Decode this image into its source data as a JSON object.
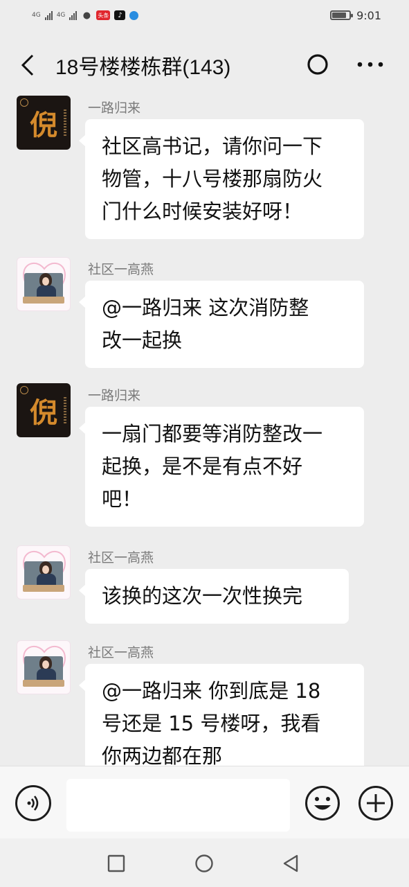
{
  "status_bar": {
    "network_1": "4G",
    "network_2": "4G",
    "time": "9:01",
    "icons": [
      "signal-icon",
      "signal-icon",
      "wechat-icon",
      "toutiao-icon",
      "tiktok-icon",
      "browser-icon"
    ],
    "battery_level": 0.85,
    "toutiao_label": "头条"
  },
  "header": {
    "title": "18号楼楼栋群(143)",
    "back_icon": "chevron-left-icon",
    "refresh_icon": "circle-icon",
    "more_icon": "more-horizontal-icon"
  },
  "messages": [
    {
      "sender": "一路归来",
      "avatar": "dark-avatar",
      "avatar_char": "倪",
      "lines": [
        "社区高书记，请你问一下",
        "物管，十八号楼那扇防火",
        "门什么时候安装好呀！"
      ]
    },
    {
      "sender": "社区一高燕",
      "avatar": "photo-avatar",
      "lines": [
        "@一路归来  这次消防整",
        "改一起换"
      ]
    },
    {
      "sender": "一路归来",
      "avatar": "dark-avatar",
      "avatar_char": "倪",
      "lines": [
        "一扇门都要等消防整改一",
        "起换，是不是有点不好",
        "吧！"
      ]
    },
    {
      "sender": "社区一高燕",
      "avatar": "photo-avatar",
      "lines": [
        "该换的这次一次性换完"
      ]
    },
    {
      "sender": "社区一高燕",
      "avatar": "photo-avatar",
      "lines": [
        "@一路归来  你到底是 18",
        "号还是 15 号楼呀，我看",
        "你两边都在那"
      ]
    }
  ],
  "input_bar": {
    "voice_icon": "voice-icon",
    "input_value": "",
    "emoji_icon": "emoji-icon",
    "plus_icon": "plus-icon"
  },
  "nav_bar": {
    "recent_icon": "square-icon",
    "home_icon": "circle-icon",
    "back_icon": "triangle-back-icon"
  }
}
